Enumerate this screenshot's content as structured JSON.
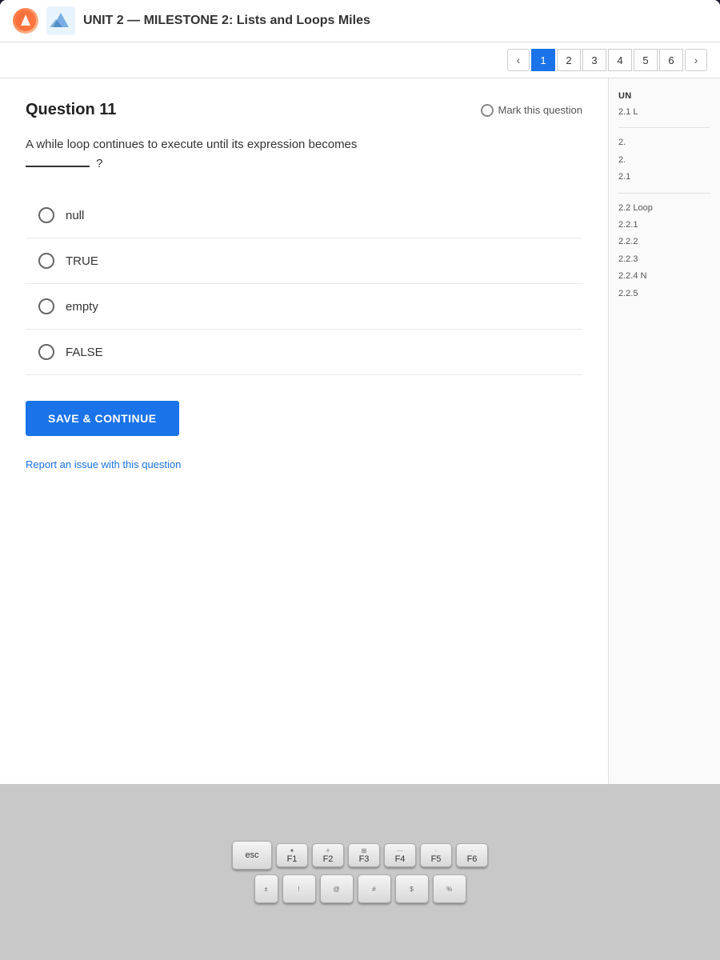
{
  "header": {
    "title": "UNIT 2 — MILESTONE 2: Lists and Loops Miles",
    "app_icon": "●"
  },
  "pagination": {
    "arrow_left": "‹",
    "pages": [
      {
        "num": "1",
        "active": true
      },
      {
        "num": "2",
        "active": false
      },
      {
        "num": "3",
        "active": false
      },
      {
        "num": "4",
        "active": false
      },
      {
        "num": "5",
        "active": false
      },
      {
        "num": "6",
        "active": false
      }
    ]
  },
  "question": {
    "title": "Question 11",
    "mark_label": "Mark this question",
    "text_part1": "A while loop continues to execute until its expression becomes",
    "text_blank": "________",
    "text_part2": "?",
    "options": [
      {
        "id": "opt-null",
        "label": "null"
      },
      {
        "id": "opt-true",
        "label": "TRUE"
      },
      {
        "id": "opt-empty",
        "label": "empty"
      },
      {
        "id": "opt-false",
        "label": "FALSE"
      }
    ],
    "save_button": "SAVE & CONTINUE",
    "report_link": "Report an issue with this question"
  },
  "sidebar": {
    "unit_label": "UN",
    "items": [
      {
        "label": "2.1 L"
      },
      {
        "label": "2."
      },
      {
        "label": "2."
      },
      {
        "label": "2.1"
      },
      {
        "label": "2.2 Loop"
      },
      {
        "label": "2.2.1"
      },
      {
        "label": "2.2.2"
      },
      {
        "label": "2.2.3"
      },
      {
        "label": "2.2.4 N"
      },
      {
        "label": "2.2.5"
      }
    ]
  },
  "keyboard": {
    "row1": [
      {
        "label": "esc",
        "top": ""
      },
      {
        "label": "F1",
        "top": ""
      },
      {
        "label": "F2",
        "top": ""
      },
      {
        "label": "F3",
        "top": ""
      },
      {
        "label": "F4",
        "top": ""
      },
      {
        "label": "F5",
        "top": ""
      },
      {
        "label": "F6",
        "top": ""
      }
    ],
    "row2": [
      {
        "label": "±",
        "top": ""
      },
      {
        "label": "!",
        "top": ""
      },
      {
        "label": "@",
        "top": ""
      },
      {
        "label": "#",
        "top": ""
      },
      {
        "label": "$",
        "top": ""
      },
      {
        "label": "%",
        "top": ""
      }
    ]
  }
}
